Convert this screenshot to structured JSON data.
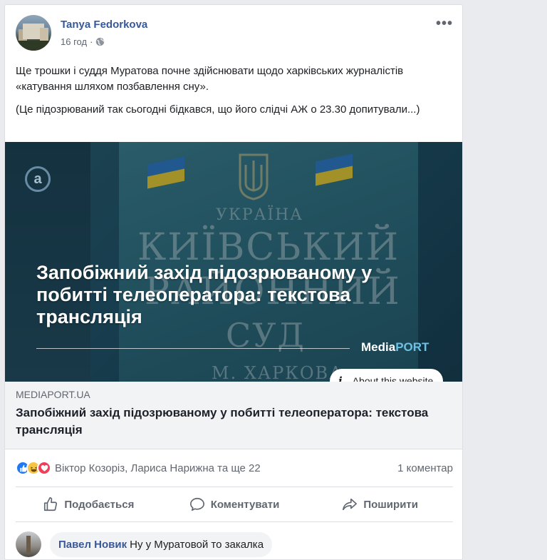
{
  "post": {
    "author": "Tanya Fedorkova",
    "time": "16 год",
    "paragraphs": [
      "Ще трошки і суддя Муратова почне здійснювати щодо харківських журналістів «катування шляхом позбавлення сну».",
      "(Це підозрюваний так сьогодні бідкався, що його слідчі АЖ о 23.30 допитували...)"
    ]
  },
  "image": {
    "overlay_title": "Запобіжний захід підозрюваному у побитті телеоператора: текстова трансляція",
    "logo_a": "Media",
    "logo_b": "PORT",
    "wm": "a",
    "plaque_lines": [
      "УКРАЇНА",
      "КИЇВСЬКИЙ",
      "РАЙОННИЙ",
      "СУД",
      "М. ХАРКОВА"
    ],
    "about": "About this website"
  },
  "link": {
    "domain": "MEDIAPORT.UA",
    "title": "Запобіжний захід підозрюваному у побитті телеоператора: текстова трансляція"
  },
  "reactions": {
    "names": "Віктор Козоріз, Лариса Нарижна та ще 22",
    "comments": "1 коментар"
  },
  "actions": {
    "like": "Подобається",
    "comment": "Коментувати",
    "share": "Поширити"
  },
  "comment": {
    "name": "Павел Новик",
    "text": "Ну у Муратовой то закалка"
  },
  "colors": {
    "link_blue": "#385898",
    "like_blue": "#2078f4",
    "love_red": "#f33e58",
    "haha_yellow": "#f7c544"
  }
}
